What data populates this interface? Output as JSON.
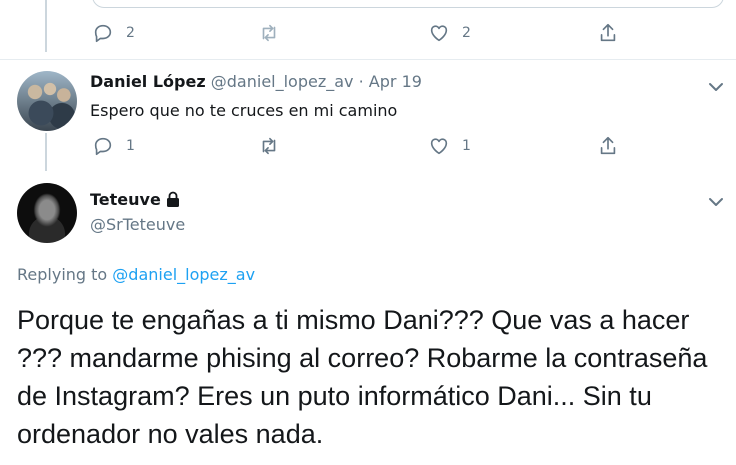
{
  "previous_tweet": {
    "actions": {
      "replies": "2",
      "retweets": "",
      "likes": "2"
    }
  },
  "reply_tweet": {
    "name": "Daniel López",
    "handle": "@daniel_lopez_av",
    "separator": "·",
    "date": "Apr 19",
    "text": "Espero que no te cruces en mi camino",
    "actions": {
      "replies": "1",
      "retweets": "",
      "likes": "1"
    }
  },
  "main_tweet": {
    "name": "Teteuve",
    "handle": "@SrTeteuve",
    "replying_prefix": "Replying to",
    "replying_to": "@daniel_lopez_av",
    "text": "Porque te engañas a ti mismo Dani??? Que vas a hacer ??? mandarme phising al correo? Robarme la contraseña de Instagram? Eres un puto informático Dani... Sin tu ordenador no vales nada."
  },
  "icons": {
    "reply": "reply-icon",
    "retweet": "retweet-icon",
    "like": "heart-icon",
    "share": "share-icon",
    "more": "chevron-down-icon",
    "protected": "lock-icon"
  },
  "colors": {
    "text": "#14171a",
    "secondary": "#657786",
    "link": "#1da1f2",
    "border": "#e6ecf0"
  }
}
